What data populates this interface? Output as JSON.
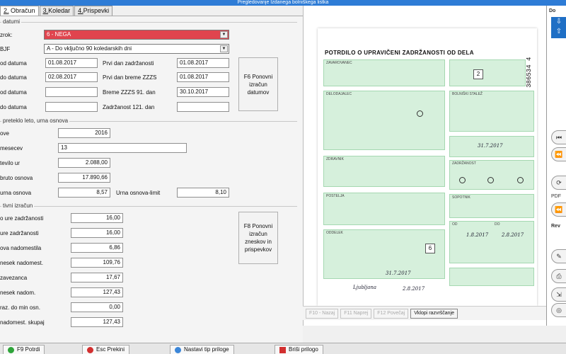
{
  "window": {
    "title": "Pregledovanje Izdanega bolniškega listka"
  },
  "tabs": [
    {
      "num": "2.",
      "label": "Obračun"
    },
    {
      "num": "3.",
      "label": "Koledar"
    },
    {
      "num": "4.",
      "label": "Prispevki"
    }
  ],
  "section_datumi": {
    "title": "datumi",
    "vzrok_label": "zrok:",
    "vzrok_value": "6 - NEGA",
    "bjf_label": "BJF",
    "bjf_value": "A - Do vključno 90 koledarskih dni",
    "od_datuma_label": "od datuma",
    "od_datuma_value": "01.08.2017",
    "prvi_dan_zadrzanosti_label": "Prvi dan zadržanosti",
    "prvi_dan_zadrzanosti_value": "01.08.2017",
    "do_datuma_label": "do datuma",
    "do_datuma_value": "02.08.2017",
    "prvi_dan_breme_label": "Prvi dan breme ZZZS",
    "prvi_dan_breme_value": "01.08.2017",
    "od_datuma2_label": "od datuma",
    "od_datuma2_value": "",
    "breme_91_label": "Breme ZZZS 91. dan",
    "breme_91_value": "30.10.2017",
    "do_datuma2_label": "do datuma",
    "do_datuma2_value": "",
    "zadrzanost_121_label": "Zadržanost 121. dan",
    "zadrzanost_121_value": "",
    "f6_button": "F6 Ponovni izračun datumov"
  },
  "section_osnova": {
    "title": "preteklo leto, urna osnova",
    "leto_label": "ove",
    "leto_value": "2016",
    "meseci_label": "mesecev",
    "meseci_value": "13",
    "stevilo_ur_label": "tevilo ur",
    "stevilo_ur_value": "2.088,00",
    "bruto_label": "bruto osnova",
    "bruto_value": "17.890,66",
    "urna_label": "urna osnova",
    "urna_value": "8,57",
    "urna_limit_label": "Urna osnova-limit",
    "urna_limit_value": "8,10"
  },
  "section_izracun": {
    "title": "tivni izračun",
    "rows": [
      {
        "label": "o ure zadržanosti",
        "value": "16,00"
      },
      {
        "label": "ure zadržanosti",
        "value": "16,00"
      },
      {
        "label": "ova nadomestila",
        "value": "6,86"
      },
      {
        "label": "nesek nadomest.",
        "value": "109,76"
      },
      {
        "label": "zavezanca",
        "value": "17,67"
      },
      {
        "label": "nesek nadom.",
        "value": "127,43"
      },
      {
        "label": "raz. do min osn.",
        "value": "0,00"
      },
      {
        "label": "nadomest. skupaj",
        "value": "127,43"
      }
    ],
    "f8_button": "F8 Ponovni izračun zneskov in prispevkov"
  },
  "document": {
    "title": "POTRDILO O UPRAVIČENI ZADRŽANOSTI OD DELA",
    "serial": "31 386534 4",
    "date_1": "31.7.2017",
    "date_from": "1.8.2017",
    "date_to": "2.8.2017",
    "date_bottom": "31.7.2017",
    "city": "Ljubljana",
    "date_sign": "2.8.2017",
    "box_value": "6",
    "box_value_2": "2",
    "small_1": "Ljubljana",
    "small_labels": [
      "ZAVAROVANEC",
      "DELODAJALEC",
      "BOLNIŠKI STALEŽ",
      "ZDRAVNIK",
      "ZADRŽANOST",
      "OD",
      "DO",
      "ODDELEK",
      "POSTELJA",
      "SOPOTNIK"
    ]
  },
  "doc_nav": {
    "prev": "F10 - Nazaj",
    "next": "F11 Naprej",
    "f12": "F12 Povečaj",
    "fit": "Vklopi razvrščanje"
  },
  "rightbar": {
    "label": "Do",
    "plus_label": "PDF",
    "rev_label": "Rev"
  },
  "bottom": {
    "f9": "F9 Potrdi",
    "esc": "Esc Prekini",
    "nastavi": "Nastavi tip priloge",
    "brisi": "Briši prilogo"
  }
}
